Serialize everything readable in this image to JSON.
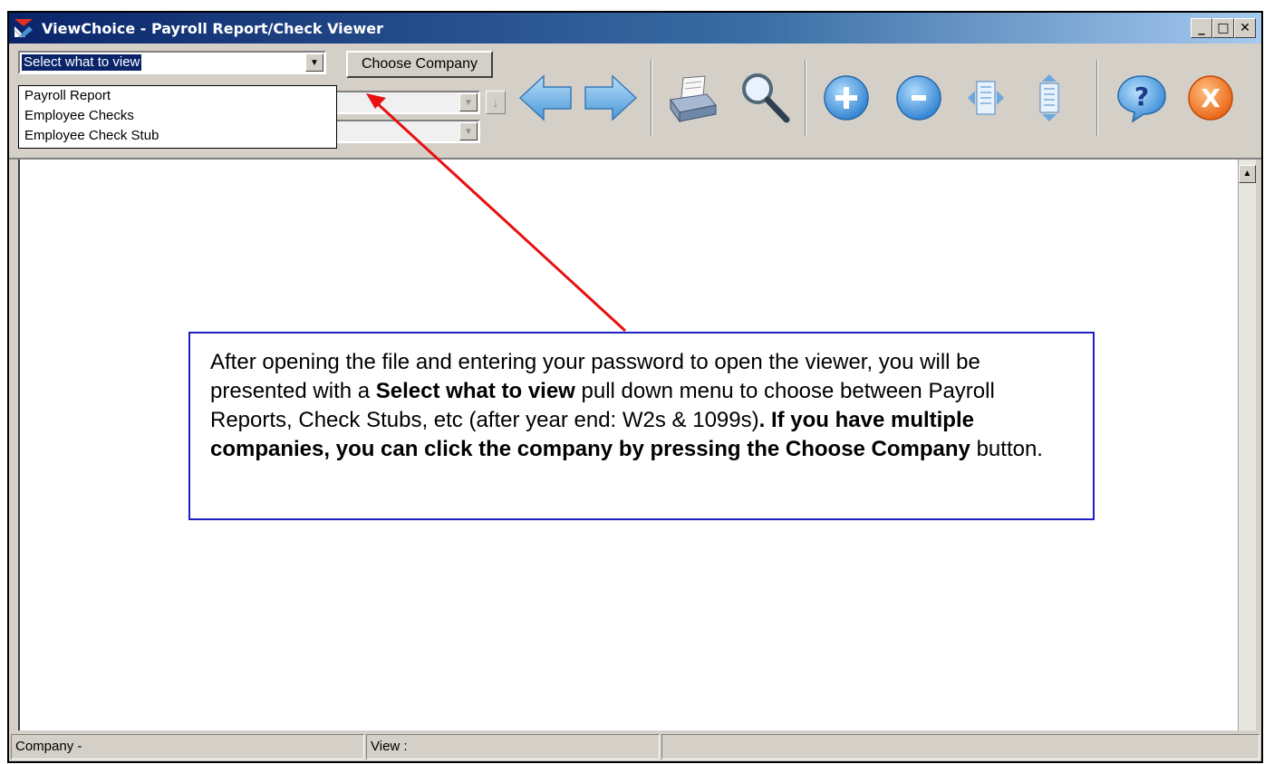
{
  "window": {
    "title": "ViewChoice - Payroll Report/Check Viewer",
    "min_label": "_",
    "max_label": "□",
    "close_label": "✕"
  },
  "toolbar": {
    "select_view": {
      "value": "Select what to view"
    },
    "choose_company_label": "Choose Company",
    "dropdown_items": [
      "Payroll Report",
      "Employee Checks",
      "Employee Check Stub"
    ],
    "nav_down_label": "↓",
    "icons": [
      "back-arrow-icon",
      "forward-arrow-icon",
      "print-icon",
      "search-icon",
      "zoom-in-icon",
      "zoom-out-icon",
      "fit-width-icon",
      "fit-height-icon",
      "help-icon",
      "exit-icon"
    ]
  },
  "status": {
    "company": "Company -",
    "view": "View :"
  },
  "callout": {
    "p1": "After opening the file and entering your password to open the viewer, you will be presented with a ",
    "b1": "Select what to view",
    "p2": " pull down menu to choose between Payroll Reports, Check Stubs, etc (after year end: W2s & 1099s)",
    "p3": ". If you have multiple companies, you can click the company by pressing the ",
    "b2": "Choose Company",
    "p4": " button."
  },
  "colors": {
    "titlebar_start": "#0a246a",
    "arrow": "#e81010",
    "callout_border": "#1f1fc4"
  }
}
